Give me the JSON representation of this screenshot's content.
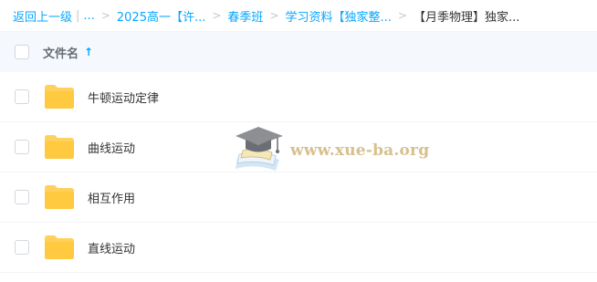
{
  "breadcrumb": {
    "back_label": "返回上一级",
    "separator_bar": "|",
    "separator": ">",
    "items": [
      "...",
      "2025高一【许...",
      "春季班",
      "学习资料【独家整...",
      "【月季物理】独家..."
    ]
  },
  "colors": {
    "accent": "#06a7ff",
    "folder": "#ffd15c",
    "header_bg": "#f5f8fd",
    "watermark": "#d7c08e"
  },
  "table": {
    "header": {
      "name_label": "文件名",
      "sort_icon": "arrow-up-icon",
      "sort_glyph": "↑"
    },
    "rows": [
      {
        "name": "牛顿运动定律",
        "icon": "folder-icon"
      },
      {
        "name": "曲线运动",
        "icon": "folder-icon"
      },
      {
        "name": "相互作用",
        "icon": "folder-icon"
      },
      {
        "name": "直线运动",
        "icon": "folder-icon"
      }
    ]
  },
  "watermark": {
    "text": "www.xue-ba.org",
    "icon": "graduation-cap-icon"
  }
}
